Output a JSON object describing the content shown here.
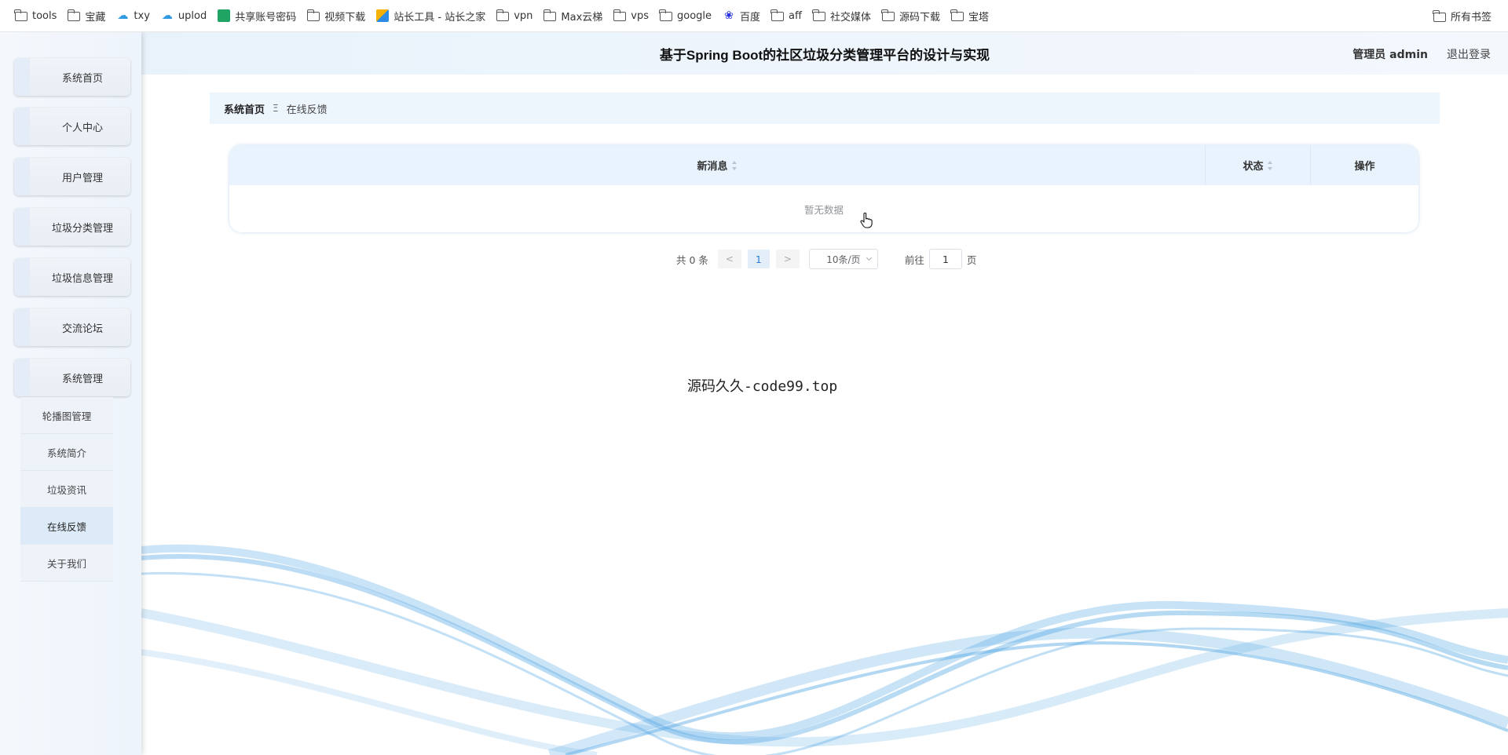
{
  "bookmarks": {
    "items": [
      {
        "label": "tools",
        "icon": "folder-icon"
      },
      {
        "label": "宝藏",
        "icon": "folder-icon"
      },
      {
        "label": "txy",
        "icon": "cloud-icon"
      },
      {
        "label": "uplod",
        "icon": "cloud-icon"
      },
      {
        "label": "共享账号密码",
        "icon": "sheet-icon"
      },
      {
        "label": "视频下载",
        "icon": "folder-icon"
      },
      {
        "label": "站长工具 - 站长之家",
        "icon": "site-icon"
      },
      {
        "label": "vpn",
        "icon": "folder-icon"
      },
      {
        "label": "Max云梯",
        "icon": "folder-icon"
      },
      {
        "label": "vps",
        "icon": "folder-icon"
      },
      {
        "label": "google",
        "icon": "folder-icon"
      },
      {
        "label": "百度",
        "icon": "baidu-icon"
      },
      {
        "label": "aff",
        "icon": "folder-icon"
      },
      {
        "label": "社交媒体",
        "icon": "folder-icon"
      },
      {
        "label": "源码下载",
        "icon": "folder-icon"
      },
      {
        "label": "宝塔",
        "icon": "folder-icon"
      }
    ],
    "all_bookmarks": "所有书签"
  },
  "header": {
    "title": "基于Spring Boot的社区垃圾分类管理平台的设计与实现",
    "user": "管理员 admin",
    "logout": "退出登录"
  },
  "sidebar": {
    "items": [
      {
        "label": "系统首页"
      },
      {
        "label": "个人中心"
      },
      {
        "label": "用户管理"
      },
      {
        "label": "垃圾分类管理"
      },
      {
        "label": "垃圾信息管理"
      },
      {
        "label": "交流论坛"
      },
      {
        "label": "系统管理"
      }
    ],
    "submenu": [
      {
        "label": "轮播图管理"
      },
      {
        "label": "系统简介"
      },
      {
        "label": "垃圾资讯"
      },
      {
        "label": "在线反馈"
      },
      {
        "label": "关于我们"
      }
    ]
  },
  "breadcrumb": {
    "home": "系统首页",
    "separator": "Ξ",
    "current": "在线反馈"
  },
  "table": {
    "columns": [
      "新消息",
      "状态",
      "操作"
    ],
    "empty_text": "暂无数据"
  },
  "pagination": {
    "total": "共 0 条",
    "prev": "<",
    "current_page": "1",
    "next": ">",
    "page_size": "10条/页",
    "goto_label": "前往",
    "goto_value": "1",
    "page_suffix": "页"
  },
  "watermark": "源码久久-code99.top",
  "colors": {
    "accent": "#2a7fd4",
    "header_bg": "#e9f2fb",
    "table_header_bg": "#e8f3fd",
    "wave": "#4aa3e0"
  }
}
